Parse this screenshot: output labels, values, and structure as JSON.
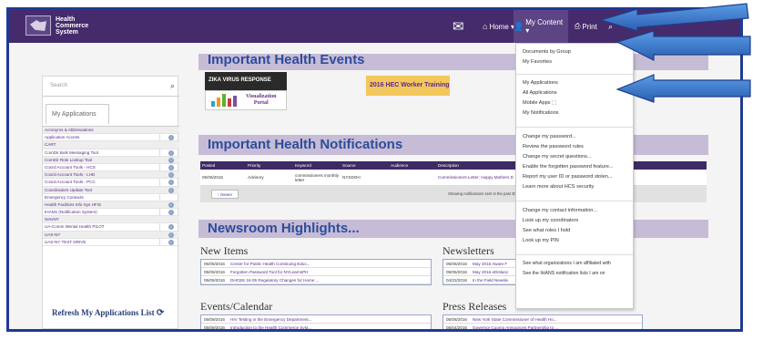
{
  "header": {
    "logo_lines": [
      "Health",
      "Commerce",
      "System"
    ],
    "nav_home": "Home ▾",
    "nav_my_content": "My Content ▾",
    "nav_print": "Print",
    "icons": [
      "mail-icon",
      "home-icon",
      "user-icon",
      "print-icon",
      "search-icon"
    ]
  },
  "left_panel": {
    "search_placeholder": "Search",
    "tab_label": "My Applications",
    "apps": [
      "Acronyms & Abbreviations",
      "Application Access",
      "CART",
      "ComDir Bulk Messaging Tool",
      "ComDir Role Lookup Tool",
      "Coord Account Tools - HCS",
      "Coord Account Tools - LHD",
      "Coord Account Tools - PCC",
      "Coordinators Update Tool",
      "Emergency Contacts",
      "Health Facilities Info Sys HFIS",
      "IHANS (Notification System)",
      "ServNY",
      "UA-Comm Mental Health PILOT",
      "UAS-NY",
      "UAS-NY TEST DRIVE"
    ],
    "refresh_label": "Refresh My Applications List"
  },
  "events": {
    "heading": "Important Health Events",
    "banner_zika": "ZIKA VIRUS RESPONSE",
    "banner_viz_line1": "Visualization",
    "banner_viz_line2": "Portal",
    "banner_hec": "2016 HEC Worker Training"
  },
  "notifications": {
    "heading": "Important Health Notifications",
    "columns": [
      "Posted",
      "Priority",
      "Keyword",
      "Source",
      "Audience",
      "Description"
    ],
    "row": {
      "posted": "05/06/2016",
      "priority": "Advisory",
      "keyword": "commissioners monthly letter",
      "source": "NYSDOH",
      "audience": "",
      "description": "Commissioners Letter: Happy Mothers D"
    },
    "newer_btn": "↑ Newer",
    "footer_note": "Showing notifications sent in the past 30 days."
  },
  "newsroom": {
    "heading": "Newsroom Highlights...",
    "new_items_heading": "New Items",
    "new_items": [
      {
        "date": "05/05/2016",
        "title": "Center for Public Health Continuing Educ..."
      },
      {
        "date": "05/05/2016",
        "title": "Forgotten Password Tool for NYLearnsPH"
      },
      {
        "date": "05/05/2016",
        "title": "DHCBS 16-05 Regulatory Changes for Home ..."
      }
    ],
    "newsletters_heading": "Newsletters",
    "newsletters": [
      {
        "date": "05/05/2016",
        "title": "May 2016 Aware F"
      },
      {
        "date": "05/05/2016",
        "title": "May 2016 eDistanc"
      },
      {
        "date": "04/22/2016",
        "title": "In the Field Newsle"
      }
    ],
    "events_heading": "Events/Calendar",
    "events": [
      {
        "date": "05/09/2016",
        "title": "HIV Testing in the Emergency Department..."
      },
      {
        "date": "05/09/2016",
        "title": "Introduction to the Health Commerce Syst..."
      }
    ],
    "press_heading": "Press Releases",
    "press": [
      {
        "date": "05/06/2016",
        "title": "New York State Commissioner of Health Ho..."
      },
      {
        "date": "05/04/2016",
        "title": "Governor Cuomo Announces Partnership to ..."
      }
    ]
  },
  "dropdown": {
    "group1": [
      "Documents by Group",
      "My Favorites"
    ],
    "group2": [
      "My Applications",
      "All Applications",
      "Mobile Apps ⬚",
      "My Notifications"
    ],
    "group3": [
      "Change my password...",
      "Review the password rules",
      "Change my secret questions...",
      "Enable the forgotten password feature...",
      "Report my user ID or password stolen...",
      "Learn more about HCS security"
    ],
    "group4": [
      "Change my contact information...",
      "Look up my coordinators",
      "See what roles I hold",
      "Look up my PIN"
    ],
    "group5": [
      "See what organizations I am affiliated with",
      "See the IHANS notification lists I am on"
    ]
  },
  "colors": {
    "header_bg": "#452b6b",
    "frame_border": "#1f3a96",
    "heading_blue": "#2d4c9b",
    "arrow_blue": "#3f7fd1"
  }
}
